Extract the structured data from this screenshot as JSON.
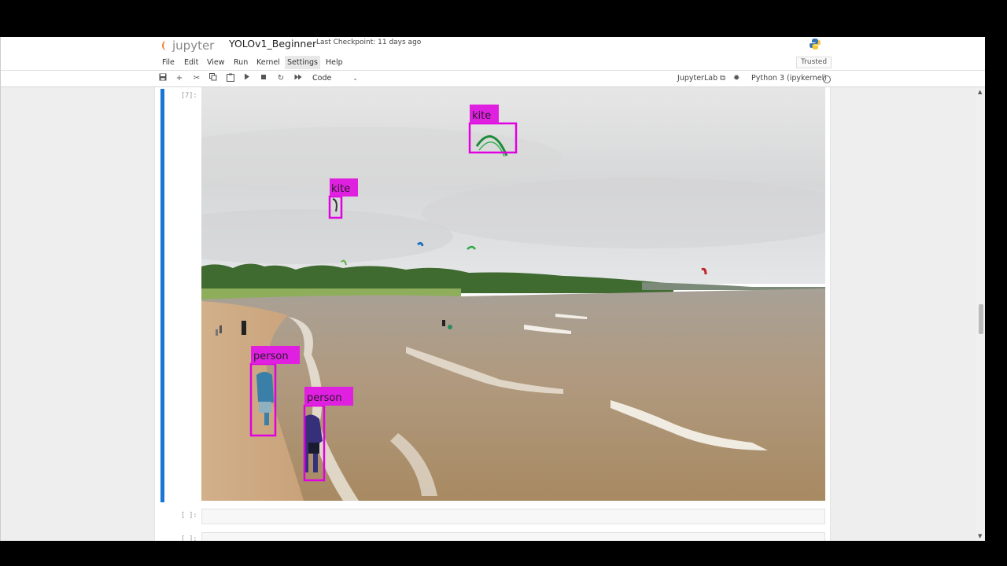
{
  "app": {
    "logo_text": "jupyter",
    "notebook_title": "YOLOv1_Beginner",
    "checkpoint": "Last Checkpoint: 11 days ago"
  },
  "menu": {
    "items": [
      "File",
      "Edit",
      "View",
      "Run",
      "Kernel",
      "Settings",
      "Help"
    ],
    "active": "Settings",
    "trusted": "Trusted"
  },
  "toolbar": {
    "icons": [
      "save-icon",
      "add-cell-icon",
      "cut-icon",
      "copy-icon",
      "paste-icon",
      "run-icon",
      "stop-icon",
      "restart-icon",
      "fast-forward-icon"
    ],
    "cell_type": "Code",
    "jupyterlab_link": "JupyterLab",
    "kernel": "Python 3 (ipykernel)"
  },
  "cells": {
    "output_prompt": "[7]:",
    "empty_prompt_1": "[ ]:",
    "empty_prompt_2": "[ ]:"
  },
  "detections": [
    {
      "label": "kite"
    },
    {
      "label": "kite"
    },
    {
      "label": "person"
    },
    {
      "label": "person"
    }
  ],
  "colors": {
    "box": "#e000e0",
    "label_bg": "#e020e0",
    "active_cell": "#1976d2"
  }
}
